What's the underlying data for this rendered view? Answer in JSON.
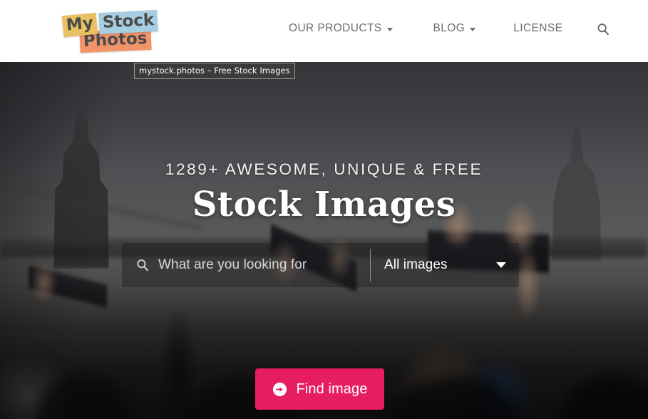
{
  "browser": {
    "tooltip": "mystock.photos – Free Stock Images"
  },
  "header": {
    "logo": {
      "word1": "My",
      "word2": "Stock",
      "word3": "Photos",
      "color1": "#e9c163",
      "color2": "#a7cde2",
      "color3": "#f2946a"
    },
    "nav": [
      {
        "label": "OUR PRODUCTS",
        "has_caret": true
      },
      {
        "label": "BLOG",
        "has_caret": true
      },
      {
        "label": "LICENSE",
        "has_caret": false
      }
    ],
    "search_icon": "search-icon"
  },
  "hero": {
    "kicker": "1289+ AWESOME, UNIQUE & FREE",
    "title": "Stock Images",
    "search": {
      "magnifier_icon": "search-icon",
      "input_value": "",
      "placeholder": "What are you looking for",
      "category_selected": "All images",
      "category_caret_icon": "chevron-down-icon"
    },
    "cta": {
      "icon": "arrow-circle-right-icon",
      "label": "Find image",
      "color": "#e71d62"
    }
  }
}
